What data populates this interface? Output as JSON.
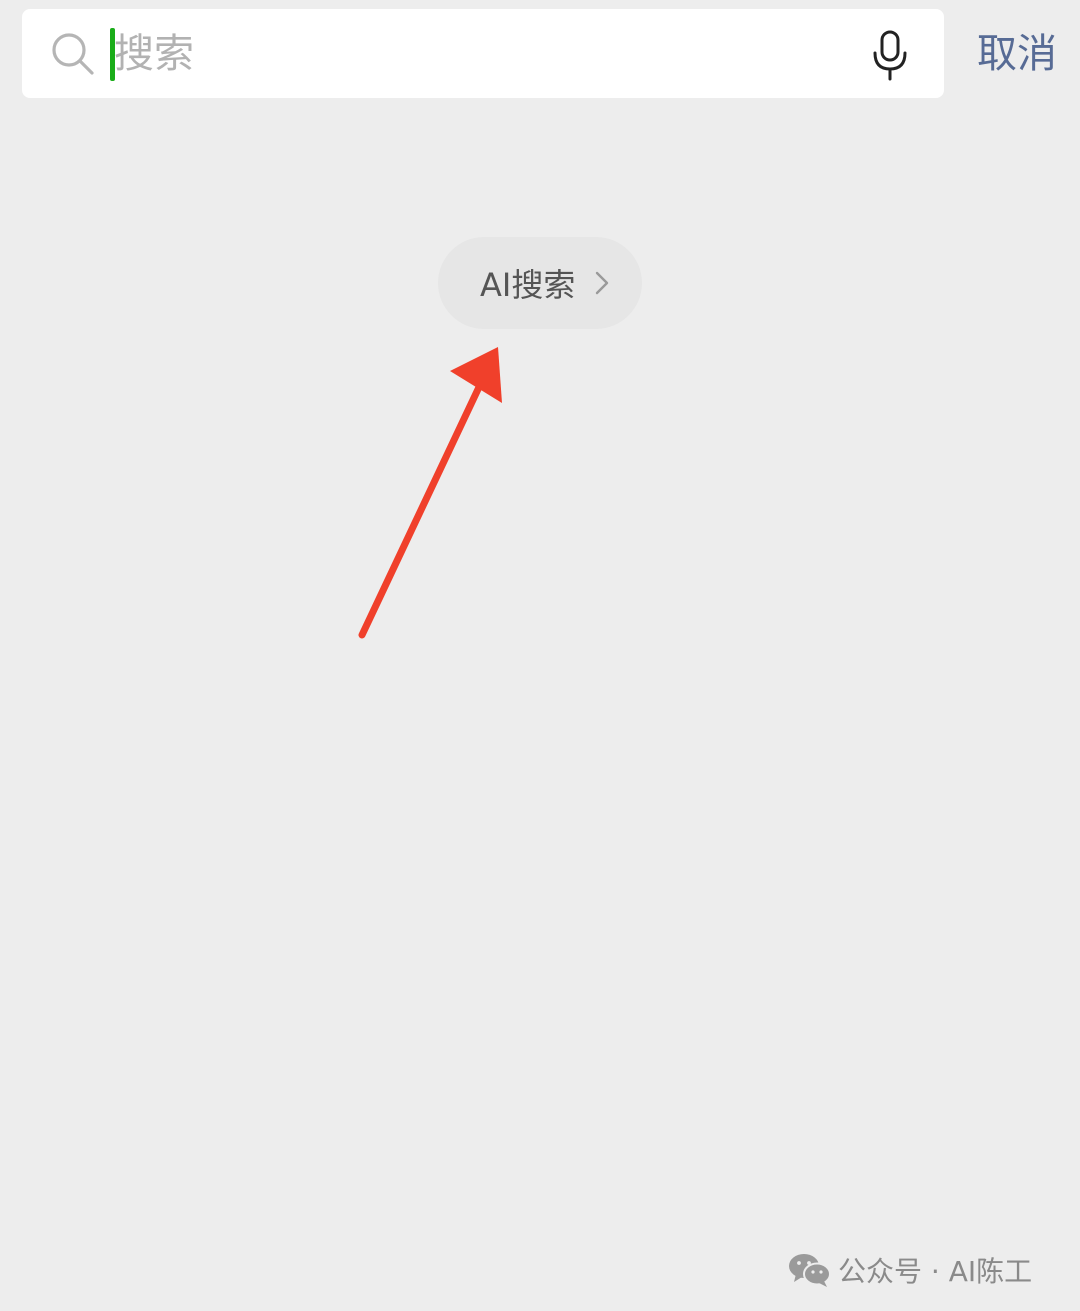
{
  "search": {
    "value": "",
    "placeholder": "搜索",
    "search_icon": "search-icon",
    "mic_icon": "microphone-icon",
    "cursor_color": "#1aad19"
  },
  "header": {
    "cancel_label": "取消",
    "cancel_color": "#576b95"
  },
  "ai_search": {
    "label": "AI搜索",
    "icon": "chevron-right-icon"
  },
  "annotation": {
    "icon": "arrow-up-icon",
    "color": "#f0402b"
  },
  "watermark": {
    "icon": "wechat-icon",
    "text": "公众号 · AI陈工"
  }
}
